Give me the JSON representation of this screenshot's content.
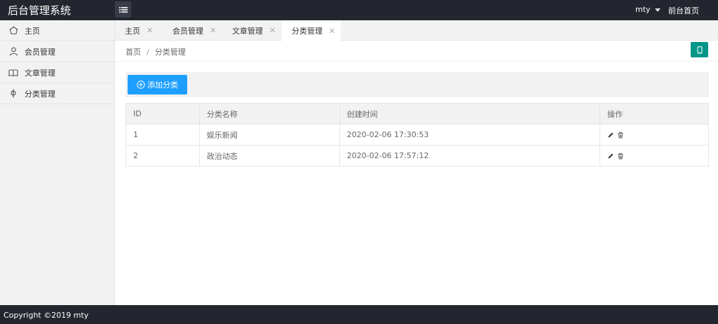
{
  "header": {
    "logo": "后台管理系统",
    "menu_toggle_icon": "hamburger-icon",
    "user": "mty",
    "front_link": "前台首页"
  },
  "sidebar": {
    "items": [
      {
        "label": "主页",
        "icon": "home-icon"
      },
      {
        "label": "会员管理",
        "icon": "user-icon"
      },
      {
        "label": "文章管理",
        "icon": "book-icon"
      },
      {
        "label": "分类管理",
        "icon": "category-icon"
      }
    ]
  },
  "tabs": [
    {
      "label": "主页",
      "close": "✕"
    },
    {
      "label": "会员管理",
      "close": "✕"
    },
    {
      "label": "文章管理",
      "close": "✕"
    },
    {
      "label": "分类管理",
      "close": "✕",
      "active": true
    }
  ],
  "breadcrumb": {
    "home": "首页",
    "separator": "/",
    "current": "分类管理"
  },
  "toolbar": {
    "add_label": "添加分类"
  },
  "table": {
    "headers": [
      "ID",
      "分类名称",
      "创建时间",
      "操作"
    ],
    "rows": [
      {
        "id": "1",
        "name": "娱乐新闻",
        "created": "2020-02-06 17:30:53"
      },
      {
        "id": "2",
        "name": "政治动态",
        "created": "2020-02-06 17:57:12"
      }
    ]
  },
  "footer": {
    "copyright": "Copyright ©2019 mty"
  },
  "colors": {
    "header_bg": "#23262e",
    "accent_teal": "#009688",
    "accent_blue": "#1e9fff",
    "sidebar_bg": "#f2f2f2"
  }
}
